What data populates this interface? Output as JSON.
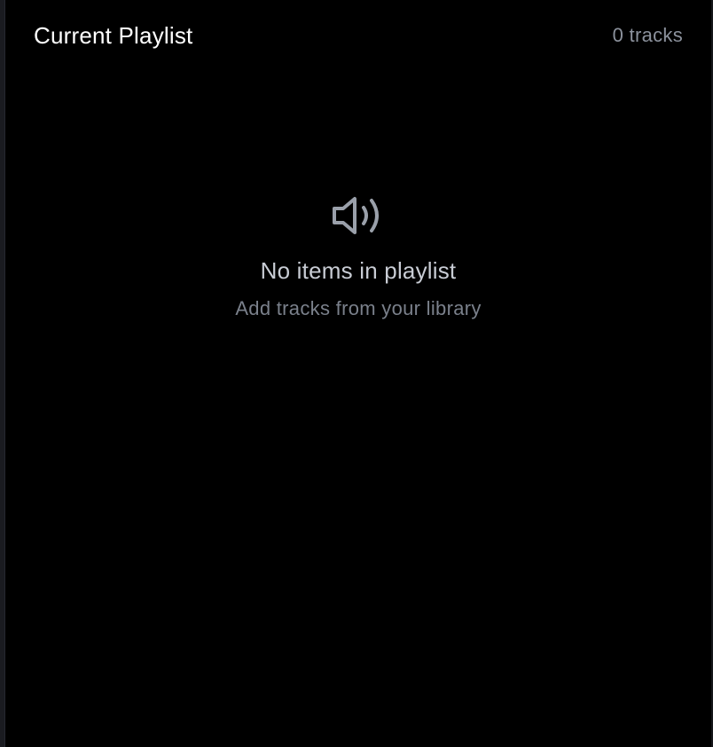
{
  "playlist": {
    "title": "Current Playlist",
    "track_count": "0 tracks"
  },
  "empty_state": {
    "icon": "speaker-icon",
    "title": "No items in playlist",
    "subtitle": "Add tracks from your library"
  },
  "colors": {
    "background": "#000000",
    "title_text": "#ffffff",
    "muted_text": "#8b919c",
    "icon": "#9aa0aa"
  }
}
